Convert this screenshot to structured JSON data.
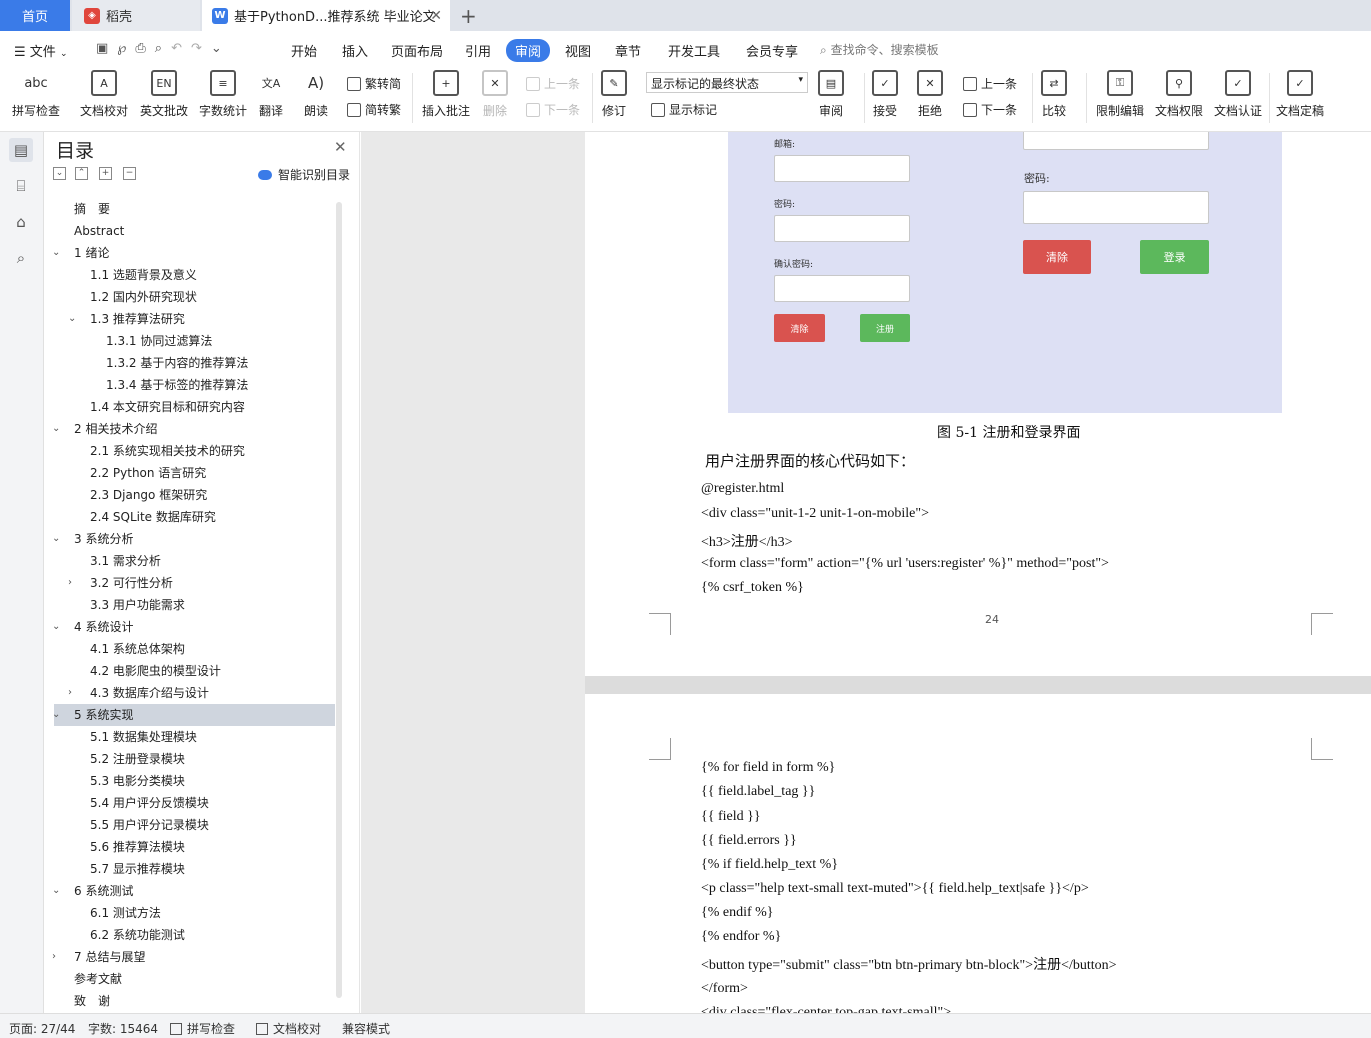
{
  "tabs": {
    "home": "首页",
    "daoke": "稻壳",
    "doc": "基于PythonD...推荐系统 毕业论文",
    "accent_color": "#3a7be8"
  },
  "menu": {
    "file": "文件",
    "items": [
      "开始",
      "插入",
      "页面布局",
      "引用",
      "审阅",
      "视图",
      "章节",
      "开发工具",
      "会员专享"
    ],
    "search": "查找命令、搜索模板"
  },
  "ribbon": {
    "spell_check": "拼写检查",
    "doc_proof": "文档校对",
    "english_review": "英文批改",
    "word_count": "字数统计",
    "translate": "翻译",
    "read_aloud": "朗读",
    "to_traditional": "繁转简",
    "to_simplified": "简转繁",
    "insert_comment": "插入批注",
    "delete": "删除",
    "prev_comment": "上一条",
    "next_comment": "下一条",
    "revise": "修订",
    "markup_state": "显示标记的最终状态",
    "show_markup": "显示标记",
    "review_pane": "审阅",
    "accept": "接受",
    "reject": "拒绝",
    "prev_change": "上一条",
    "next_change": "下一条",
    "compare": "比较",
    "restrict_edit": "限制编辑",
    "doc_permission": "文档权限",
    "doc_certify": "文档认证",
    "doc_finalize": "文档定稿"
  },
  "toc": {
    "title": "目录",
    "smart_detect": "智能识别目录",
    "items": [
      {
        "label": "摘　要",
        "level": 0,
        "chev": ""
      },
      {
        "label": "Abstract",
        "level": 0,
        "chev": ""
      },
      {
        "label": "1 绪论",
        "level": 0,
        "chev": "v"
      },
      {
        "label": "1.1 选题背景及意义",
        "level": 1,
        "chev": ""
      },
      {
        "label": "1.2 国内外研究现状",
        "level": 1,
        "chev": ""
      },
      {
        "label": "1.3 推荐算法研究",
        "level": 1,
        "chev": "v"
      },
      {
        "label": "1.3.1 协同过滤算法",
        "level": 2,
        "chev": ""
      },
      {
        "label": "1.3.2 基于内容的推荐算法",
        "level": 2,
        "chev": ""
      },
      {
        "label": "1.3.4 基于标签的推荐算法",
        "level": 2,
        "chev": ""
      },
      {
        "label": "1.4 本文研究目标和研究内容",
        "level": 1,
        "chev": ""
      },
      {
        "label": "2 相关技术介绍",
        "level": 0,
        "chev": "v"
      },
      {
        "label": "2.1 系统实现相关技术的研究",
        "level": 1,
        "chev": ""
      },
      {
        "label": "2.2 Python 语言研究",
        "level": 1,
        "chev": ""
      },
      {
        "label": "2.3 Django 框架研究",
        "level": 1,
        "chev": ""
      },
      {
        "label": "2.4 SQLite 数据库研究",
        "level": 1,
        "chev": ""
      },
      {
        "label": "3 系统分析",
        "level": 0,
        "chev": "v"
      },
      {
        "label": "3.1 需求分析",
        "level": 1,
        "chev": ""
      },
      {
        "label": "3.2 可行性分析",
        "level": 1,
        "chev": ">"
      },
      {
        "label": "3.3 用户功能需求",
        "level": 1,
        "chev": ""
      },
      {
        "label": "4 系统设计",
        "level": 0,
        "chev": "v"
      },
      {
        "label": "4.1 系统总体架构",
        "level": 1,
        "chev": ""
      },
      {
        "label": "4.2 电影爬虫的模型设计",
        "level": 1,
        "chev": ""
      },
      {
        "label": "4.3 数据库介绍与设计",
        "level": 1,
        "chev": ">"
      },
      {
        "label": "5 系统实现",
        "level": 0,
        "chev": "v",
        "selected": true
      },
      {
        "label": "5.1 数据集处理模块",
        "level": 1,
        "chev": ""
      },
      {
        "label": "5.2 注册登录模块",
        "level": 1,
        "chev": ""
      },
      {
        "label": "5.3 电影分类模块",
        "level": 1,
        "chev": ""
      },
      {
        "label": "5.4 用户评分反馈模块",
        "level": 1,
        "chev": ""
      },
      {
        "label": "5.5 用户评分记录模块",
        "level": 1,
        "chev": ""
      },
      {
        "label": "5.6 推荐算法模块",
        "level": 1,
        "chev": ""
      },
      {
        "label": "5.7 显示推荐模块",
        "level": 1,
        "chev": ""
      },
      {
        "label": "6 系统测试",
        "level": 0,
        "chev": "v"
      },
      {
        "label": "6.1 测试方法",
        "level": 1,
        "chev": ""
      },
      {
        "label": "6.2 系统功能测试",
        "level": 1,
        "chev": ""
      },
      {
        "label": "7 总结与展望",
        "level": 0,
        "chev": ">"
      },
      {
        "label": "参考文献",
        "level": 0,
        "chev": ""
      },
      {
        "label": "致　谢",
        "level": 0,
        "chev": ""
      }
    ]
  },
  "figure": {
    "reg_email_label": "邮箱:",
    "reg_password_label": "密码:",
    "reg_confirm_label": "确认密码:",
    "reg_clear": "清除",
    "reg_register": "注册",
    "login_password_label": "密码:",
    "login_clear": "清除",
    "login_login": "登录",
    "caption": "图 5-1 注册和登录界面"
  },
  "page1": {
    "intro": "用户注册界面的核心代码如下：",
    "code": [
      "@register.html",
      "<div class=\"unit-1-2 unit-1-on-mobile\">",
      "<h3>注册</h3>",
      "<form class=\"form\" action=\"{% url 'users:register' %}\" method=\"post\">",
      "{% csrf_token %}"
    ],
    "page_number": "24"
  },
  "page2": {
    "code": [
      "{% for field in form %}",
      "{{ field.label_tag }}",
      "{{ field }}",
      "{{ field.errors }}",
      "{% if field.help_text %}",
      "<p class=\"help text-small text-muted\">{{ field.help_text|safe }}</p>",
      "{% endif %}",
      "{% endfor %}",
      "<button type=\"submit\" class=\"btn btn-primary btn-block\">注册</button>",
      "</form>",
      "<div class=\"flex-center top-gap text-small\">"
    ]
  },
  "status": {
    "page": "页面: 27/44",
    "words": "字数: 15464",
    "spell": "拼写检查",
    "proof": "文档校对",
    "compat": "兼容模式"
  }
}
